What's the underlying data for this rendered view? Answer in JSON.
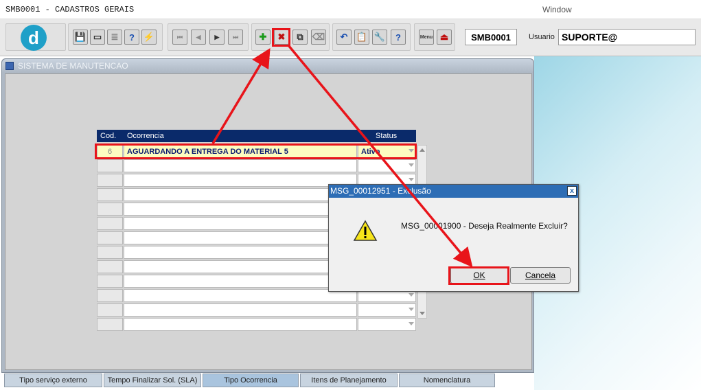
{
  "app": {
    "title": "SMB0001 - CADASTROS GERAIS",
    "window_menu": "Window"
  },
  "toolbar": {
    "logo_letter": "d",
    "module_code": "SMB0001",
    "user_label": "Usuario",
    "user_value": "SUPORTE@",
    "buttons": {
      "save": "💾",
      "print": "▭",
      "list": "≣",
      "query": "?",
      "execute": "⚡",
      "first": "⏮",
      "prev": "◀",
      "next": "▶",
      "last": "⏭",
      "insert": "✚",
      "delete": "✖",
      "duplicate": "⧉",
      "clear": "⌫",
      "undo": "↶",
      "copy": "📋",
      "tools": "🔧",
      "help": "?",
      "menu": "Menu",
      "exit": "⏏"
    }
  },
  "window": {
    "title": "SISTEMA DE MANUTENCAO"
  },
  "grid": {
    "columns": [
      "Cod.",
      "Ocorrencia",
      "Status"
    ],
    "rows": [
      {
        "cod": "6",
        "ocorrencia": "AGUARDANDO A ENTREGA DO MATERIAL 5",
        "status": "Ativo"
      }
    ],
    "empty_rows": 12
  },
  "dialog": {
    "title": "MSG_00012951 - Exclusão",
    "message": "MSG_00001900 - Deseja Realmente Excluir?",
    "ok_label": "OK",
    "cancel_label": "Cancela",
    "close_label": "x"
  },
  "tabs": [
    {
      "label": "Tipo serviço externo"
    },
    {
      "label": "Tempo Finalizar Sol. (SLA)"
    },
    {
      "label": "Tipo Ocorrencia"
    },
    {
      "label": "Itens de Planejamento"
    },
    {
      "label": "Nomenclatura"
    }
  ],
  "colors": {
    "grid_header": "#0a2a6a",
    "selected_row": "#fdfcc0",
    "dialog_title": "#2d6db5",
    "annotation": "#e8141a"
  }
}
